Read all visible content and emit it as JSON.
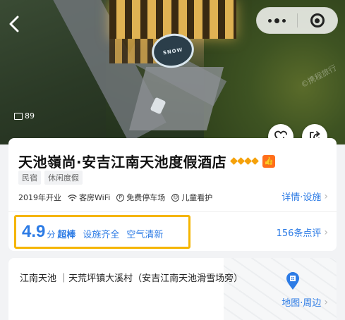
{
  "hero": {
    "photo_count": "89",
    "building_sign": "SNOW",
    "watermark": "©携程旅行"
  },
  "hotel": {
    "name": "天池嶺尚·安吉江南天池度假酒店",
    "diamond_count": 4,
    "diamond_color": "#f5a10a",
    "tags": [
      "民宿",
      "休闲度假"
    ],
    "amenities": [
      {
        "label": "2019年开业",
        "icon": ""
      },
      {
        "label": "客房WiFi",
        "icon": "wifi-icon"
      },
      {
        "label": "免费停车场",
        "icon": "parking-icon"
      },
      {
        "label": "儿童看护",
        "icon": "child-care-icon"
      }
    ],
    "detail_link": "详情·设施"
  },
  "rating": {
    "score": "4.9",
    "unit": "分",
    "level": "超棒",
    "tags": [
      "设施齐全",
      "空气清新"
    ],
    "reviews_link": "156条点评"
  },
  "address": {
    "text": "江南天池 ｜天荒坪镇大溪村（安吉江南天池滑雪场旁）",
    "map_link": "地图·周边"
  },
  "colors": {
    "accent": "#2c7be5",
    "highlight_border": "#f5b500",
    "badge": "#ff6f1b"
  }
}
